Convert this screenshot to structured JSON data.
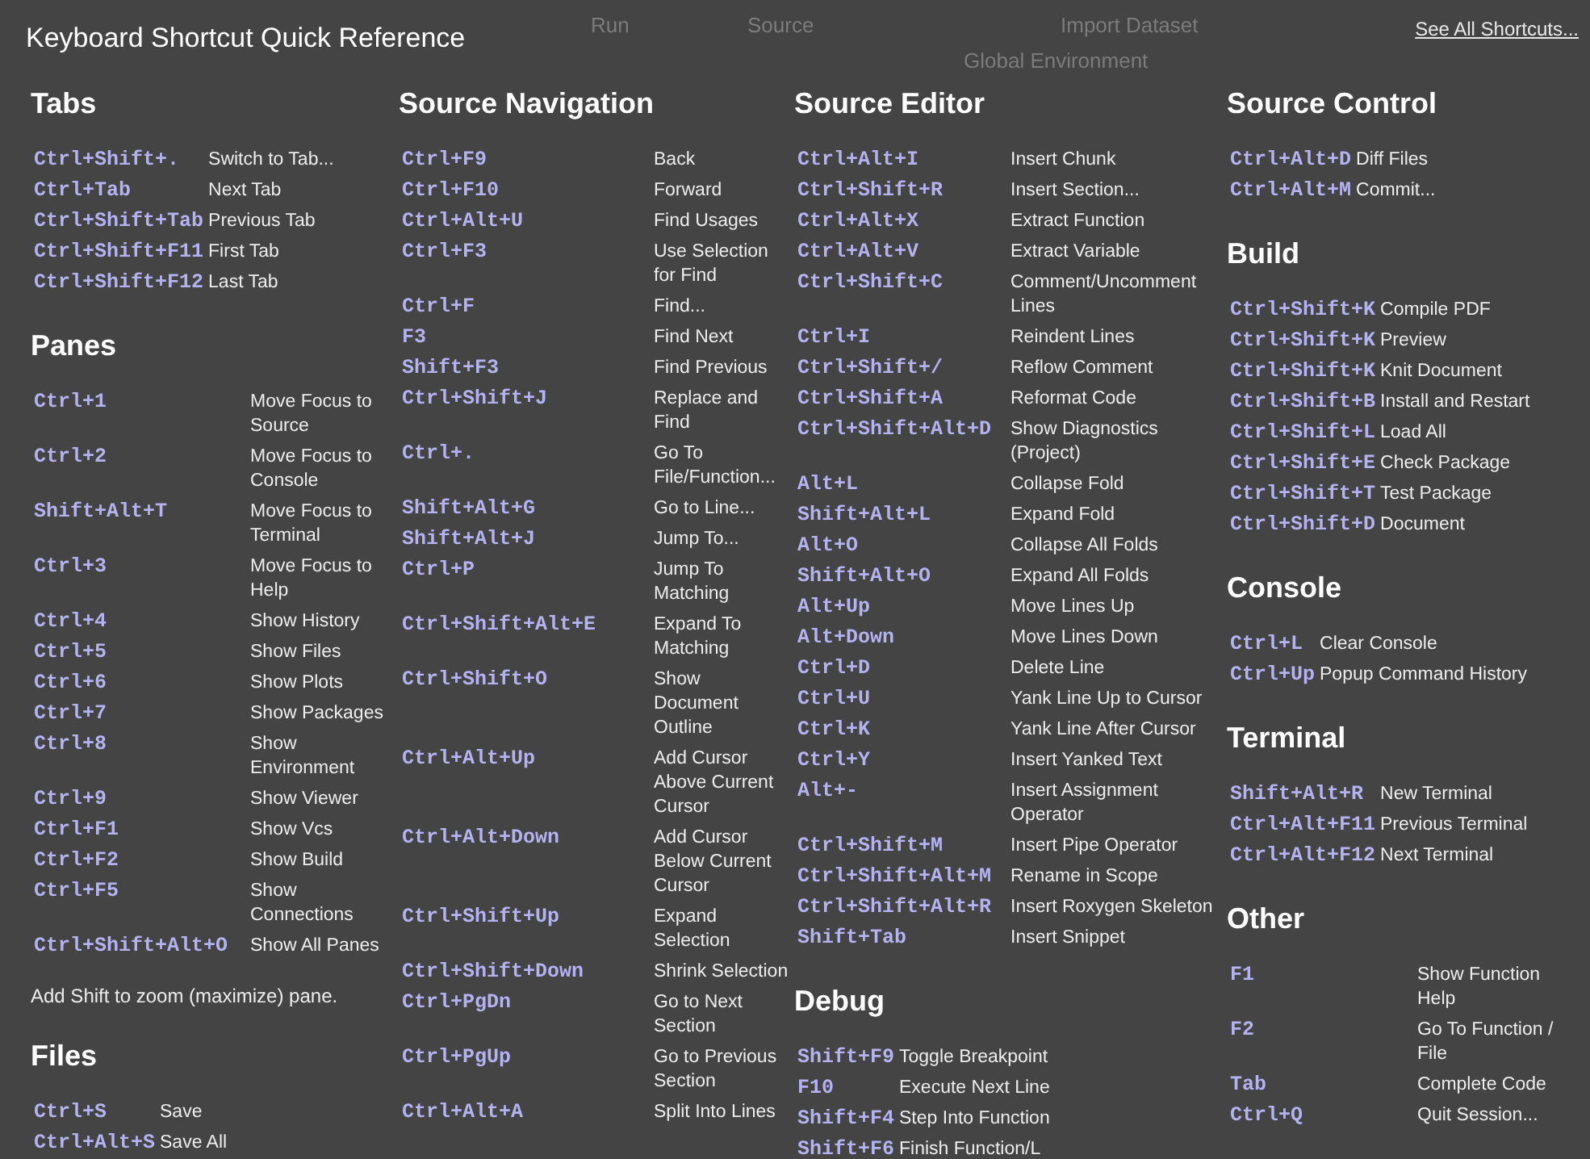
{
  "title": "Keyboard Shortcut Quick Reference",
  "see_all_link": "See All Shortcuts...",
  "columns": [
    {
      "sections": [
        {
          "heading": "Tabs",
          "rows": [
            {
              "keys": "Ctrl+Shift+.",
              "action": "Switch to Tab..."
            },
            {
              "keys": "Ctrl+Tab",
              "action": "Next Tab"
            },
            {
              "keys": "Ctrl+Shift+Tab",
              "action": "Previous Tab"
            },
            {
              "keys": "Ctrl+Shift+F11",
              "action": "First Tab"
            },
            {
              "keys": "Ctrl+Shift+F12",
              "action": "Last Tab"
            }
          ]
        },
        {
          "heading": "Panes",
          "note": "Add Shift to zoom (maximize) pane.",
          "rows": [
            {
              "keys": "Ctrl+1",
              "action": "Move Focus to Source"
            },
            {
              "keys": "Ctrl+2",
              "action": "Move Focus to Console"
            },
            {
              "keys": "Shift+Alt+T",
              "action": "Move Focus to Terminal"
            },
            {
              "keys": "Ctrl+3",
              "action": "Move Focus to Help"
            },
            {
              "keys": "Ctrl+4",
              "action": "Show History"
            },
            {
              "keys": "Ctrl+5",
              "action": "Show Files"
            },
            {
              "keys": "Ctrl+6",
              "action": "Show Plots"
            },
            {
              "keys": "Ctrl+7",
              "action": "Show Packages"
            },
            {
              "keys": "Ctrl+8",
              "action": "Show Environment"
            },
            {
              "keys": "Ctrl+9",
              "action": "Show Viewer"
            },
            {
              "keys": "Ctrl+F1",
              "action": "Show Vcs"
            },
            {
              "keys": "Ctrl+F2",
              "action": "Show Build"
            },
            {
              "keys": "Ctrl+F5",
              "action": "Show Connections"
            },
            {
              "keys": "Ctrl+Shift+Alt+O",
              "action": "Show All Panes"
            }
          ]
        },
        {
          "heading": "Files",
          "rows": [
            {
              "keys": "Ctrl+S",
              "action": "Save"
            },
            {
              "keys": "Ctrl+Alt+S",
              "action": "Save All"
            }
          ]
        }
      ]
    },
    {
      "sections": [
        {
          "heading": "Source Navigation",
          "rows": [
            {
              "keys": "Ctrl+F9",
              "action": "Back"
            },
            {
              "keys": "Ctrl+F10",
              "action": "Forward"
            },
            {
              "keys": "Ctrl+Alt+U",
              "action": "Find Usages"
            },
            {
              "keys": "Ctrl+F3",
              "action": "Use Selection for Find"
            },
            {
              "keys": "Ctrl+F",
              "action": "Find..."
            },
            {
              "keys": "F3",
              "action": "Find Next"
            },
            {
              "keys": "Shift+F3",
              "action": "Find Previous"
            },
            {
              "keys": "Ctrl+Shift+J",
              "action": "Replace and Find"
            },
            {
              "keys": "Ctrl+.",
              "action": "Go To File/Function..."
            },
            {
              "keys": "Shift+Alt+G",
              "action": "Go to Line..."
            },
            {
              "keys": "Shift+Alt+J",
              "action": "Jump To..."
            },
            {
              "keys": "Ctrl+P",
              "action": "Jump To Matching"
            },
            {
              "keys": "Ctrl+Shift+Alt+E",
              "action": "Expand To Matching"
            },
            {
              "keys": "Ctrl+Shift+O",
              "action": "Show Document Outline"
            },
            {
              "keys": "Ctrl+Alt+Up",
              "action": "Add Cursor Above Current Cursor"
            },
            {
              "keys": "Ctrl+Alt+Down",
              "action": "Add Cursor Below Current Cursor"
            },
            {
              "keys": "Ctrl+Shift+Up",
              "action": "Expand Selection"
            },
            {
              "keys": "Ctrl+Shift+Down",
              "action": "Shrink Selection"
            },
            {
              "keys": "Ctrl+PgDn",
              "action": "Go to Next Section"
            },
            {
              "keys": "Ctrl+PgUp",
              "action": "Go to Previous Section"
            },
            {
              "keys": "Ctrl+Alt+A",
              "action": "Split Into Lines"
            }
          ]
        }
      ]
    },
    {
      "sections": [
        {
          "heading": "Source Editor",
          "rows": [
            {
              "keys": "Ctrl+Alt+I",
              "action": "Insert Chunk"
            },
            {
              "keys": "Ctrl+Shift+R",
              "action": "Insert Section..."
            },
            {
              "keys": "Ctrl+Alt+X",
              "action": "Extract Function"
            },
            {
              "keys": "Ctrl+Alt+V",
              "action": "Extract Variable"
            },
            {
              "keys": "Ctrl+Shift+C",
              "action": "Comment/Uncomment Lines"
            },
            {
              "keys": "Ctrl+I",
              "action": "Reindent Lines"
            },
            {
              "keys": "Ctrl+Shift+/",
              "action": "Reflow Comment"
            },
            {
              "keys": "Ctrl+Shift+A",
              "action": "Reformat Code"
            },
            {
              "keys": "Ctrl+Shift+Alt+D",
              "action": "Show Diagnostics (Project)"
            },
            {
              "keys": "Alt+L",
              "action": "Collapse Fold"
            },
            {
              "keys": "Shift+Alt+L",
              "action": "Expand Fold"
            },
            {
              "keys": "Alt+O",
              "action": "Collapse All Folds"
            },
            {
              "keys": "Shift+Alt+O",
              "action": "Expand All Folds"
            },
            {
              "keys": "Alt+Up",
              "action": "Move Lines Up"
            },
            {
              "keys": "Alt+Down",
              "action": "Move Lines Down"
            },
            {
              "keys": "Ctrl+D",
              "action": "Delete Line"
            },
            {
              "keys": "Ctrl+U",
              "action": "Yank Line Up to Cursor"
            },
            {
              "keys": "Ctrl+K",
              "action": "Yank Line After Cursor"
            },
            {
              "keys": "Ctrl+Y",
              "action": "Insert Yanked Text"
            },
            {
              "keys": "Alt+-",
              "action": "Insert Assignment Operator"
            },
            {
              "keys": "Ctrl+Shift+M",
              "action": "Insert Pipe Operator"
            },
            {
              "keys": "Ctrl+Shift+Alt+M",
              "action": "Rename in Scope"
            },
            {
              "keys": "Ctrl+Shift+Alt+R",
              "action": "Insert Roxygen Skeleton"
            },
            {
              "keys": "Shift+Tab",
              "action": "Insert Snippet"
            }
          ]
        },
        {
          "heading": "Debug",
          "rows": [
            {
              "keys": "Shift+F9",
              "action": "Toggle Breakpoint"
            },
            {
              "keys": "F10",
              "action": "Execute Next Line"
            },
            {
              "keys": "Shift+F4",
              "action": "Step Into Function"
            },
            {
              "keys": "Shift+F6",
              "action": "Finish Function/L"
            }
          ]
        }
      ]
    },
    {
      "sections": [
        {
          "heading": "Source Control",
          "rows": [
            {
              "keys": "Ctrl+Alt+D",
              "action": "Diff Files"
            },
            {
              "keys": "Ctrl+Alt+M",
              "action": "Commit..."
            }
          ]
        },
        {
          "heading": "Build",
          "rows": [
            {
              "keys": "Ctrl+Shift+K",
              "action": "Compile PDF"
            },
            {
              "keys": "Ctrl+Shift+K",
              "action": "Preview"
            },
            {
              "keys": "Ctrl+Shift+K",
              "action": "Knit Document"
            },
            {
              "keys": "Ctrl+Shift+B",
              "action": "Install and Restart"
            },
            {
              "keys": "Ctrl+Shift+L",
              "action": "Load All"
            },
            {
              "keys": "Ctrl+Shift+E",
              "action": "Check Package"
            },
            {
              "keys": "Ctrl+Shift+T",
              "action": "Test Package"
            },
            {
              "keys": "Ctrl+Shift+D",
              "action": "Document"
            }
          ]
        },
        {
          "heading": "Console",
          "rows": [
            {
              "keys": "Ctrl+L",
              "action": "Clear Console"
            },
            {
              "keys": "Ctrl+Up",
              "action": "Popup Command History"
            }
          ]
        },
        {
          "heading": "Terminal",
          "rows": [
            {
              "keys": "Shift+Alt+R",
              "action": "New Terminal"
            },
            {
              "keys": "Ctrl+Alt+F11",
              "action": "Previous Terminal"
            },
            {
              "keys": "Ctrl+Alt+F12",
              "action": "Next Terminal"
            }
          ]
        },
        {
          "heading": "Other",
          "rows": [
            {
              "keys": "F1",
              "action": "Show Function Help"
            },
            {
              "keys": "F2",
              "action": "Go To Function / File"
            },
            {
              "keys": "Tab",
              "action": "Complete Code"
            },
            {
              "keys": "Ctrl+Q",
              "action": "Quit Session..."
            }
          ]
        }
      ]
    }
  ],
  "background": [
    {
      "text": "Run",
      "kind": "ui"
    },
    {
      "text": "Source",
      "kind": "ui"
    },
    {
      "text": "Import Dataset",
      "kind": "ui"
    },
    {
      "text": "Global Environment",
      "kind": "ui"
    }
  ]
}
